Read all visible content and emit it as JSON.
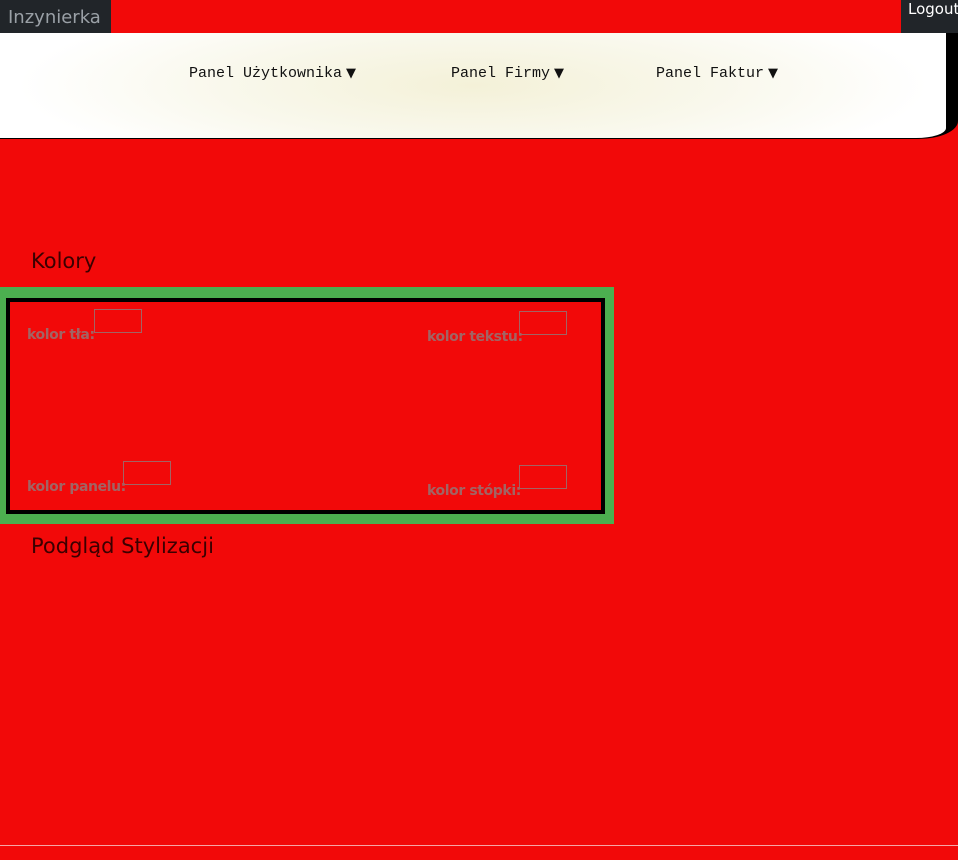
{
  "navbar": {
    "brand": "Inzynierka",
    "logout_label": "Logout"
  },
  "menu": {
    "items": [
      {
        "label": "Panel Użytkownika",
        "arrow": "▼"
      },
      {
        "label": "Panel Firmy",
        "arrow": "▼"
      },
      {
        "label": "Panel Faktur",
        "arrow": "▼"
      }
    ]
  },
  "colors_section": {
    "heading": "Kolory",
    "fields": {
      "background": {
        "label": "kolor tła:"
      },
      "text": {
        "label": "kolor tekstu:"
      },
      "panel": {
        "label": "kolor panelu:"
      },
      "footer": {
        "label": "kolor stópki:"
      }
    }
  },
  "preview_section": {
    "heading": "Podgląd Stylizacji"
  },
  "theme": {
    "page_background": "#f20909",
    "panel_border": "#4caf50",
    "navbar_background": "#212529"
  }
}
